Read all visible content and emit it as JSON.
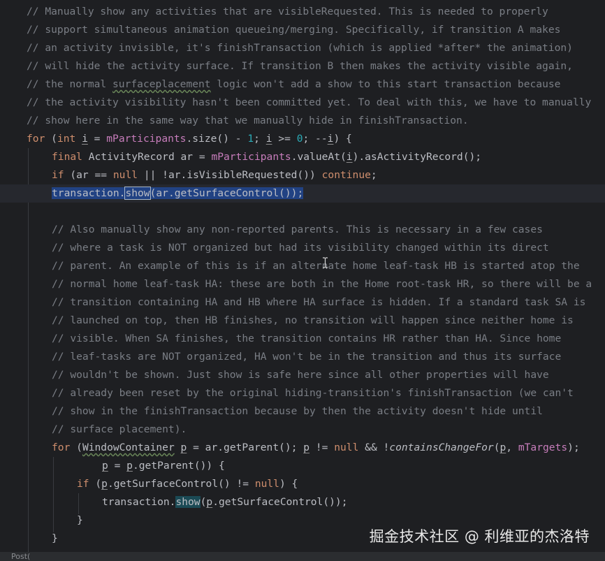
{
  "editor": {
    "lines": [
      "// Manually show any activities that are visibleRequested. This is needed to properly",
      "// support simultaneous animation queueing/merging. Specifically, if transition A makes",
      "// an activity invisible, it's finishTransaction (which is applied *after* the animation)",
      "// will hide the activity surface. If transition B then makes the activity visible again,",
      "// the normal ",
      "surfaceplacement",
      " logic won't add a show to this start transaction because",
      "// the activity visibility hasn't been committed yet. To deal with this, we have to manually",
      "// show here in the same way that we manually hide in finishTransaction."
    ],
    "loop1": {
      "kw_for": "for",
      "paren_open": " (",
      "kw_int": "int",
      "space": " ",
      "var_i": "i",
      "eq": " = ",
      "field": "mParticipants",
      "size": ".size() - ",
      "num1": "1",
      "semi": "; ",
      "i2": "i",
      "ge": " >= ",
      "num0": "0",
      "semi2": "; --",
      "i3": "i",
      "close": ") {"
    },
    "line_final": {
      "kw_final": "final",
      "type": " ActivityRecord ar = ",
      "field": "mParticipants",
      "rest1": ".valueAt(",
      "i": "i",
      "rest2": ").asActivityRecord();"
    },
    "line_if": {
      "kw_if": "if",
      "p1": " (ar == ",
      "kw_null": "null",
      "p2": " || !ar.isVisibleRequested()) ",
      "kw_continue": "continue",
      "p3": ";"
    },
    "line_show1": {
      "a": "transaction.",
      "b": "show",
      "c": "(ar.getSurfaceControl());"
    },
    "comment2": [
      "// Also manually show any non-reported parents. This is necessary in a few cases",
      "// where a task is NOT organized but had its visibility changed within its direct",
      "// parent. An example of this is if an alternate home leaf-task HB is started atop the",
      "// normal home leaf-task HA: these are both in the Home root-task HR, so there will be a",
      "// transition containing HA and HB where HA surface is hidden. If a standard task SA is",
      "// launched on top, then HB finishes, no transition will happen since neither home is",
      "// visible. When SA finishes, the transition contains HR rather than HA. Since home",
      "// leaf-tasks are NOT organized, HA won't be in the transition and thus its surface",
      "// wouldn't be shown. Just show is safe here since all other properties will have",
      "// already been reset by the original hiding-transition's finishTransaction (we can't",
      "// show in the finishTransaction because by then the activity doesn't hide until",
      "// surface placement)."
    ],
    "loop2": {
      "kw_for": "for",
      "p1": " (",
      "type": "WindowContainer",
      "p2": " ",
      "p": "p",
      "p3": " = ar.getParent(); ",
      "p4": "p",
      "p5": " != ",
      "kw_null": "null",
      "p6": " && !",
      "fn": "containsChangeFor",
      "p7": "(",
      "p8": "p",
      "p9": ", ",
      "field": "mTargets",
      "p10": ");"
    },
    "loop2_cont": {
      "p": "p",
      "eq": " = ",
      "p2": "p",
      "rest": ".getParent()) {"
    },
    "line_if2": {
      "kw_if": "if",
      "p1": " (",
      "p": "p",
      "p2": ".getSurfaceControl() != ",
      "kw_null": "null",
      "p3": ") {"
    },
    "line_show2": {
      "a": "transaction.",
      "b": "show",
      "c": "(",
      "p": "p",
      "d": ".getSurfaceControl());"
    },
    "brace_inner": "}",
    "brace_outer": "}"
  },
  "status_fragment": "Post(",
  "watermark": "掘金技术社区 @ 利维亚的杰洛特",
  "icons": {
    "text_caret": "text-cursor-icon"
  },
  "colors": {
    "background": "#1e1f22",
    "comment": "#7a7e85",
    "keyword": "#cf8e6d",
    "field": "#c77dbb",
    "number": "#2aacb8",
    "function": "#56a8f5",
    "selection": "#214283"
  }
}
